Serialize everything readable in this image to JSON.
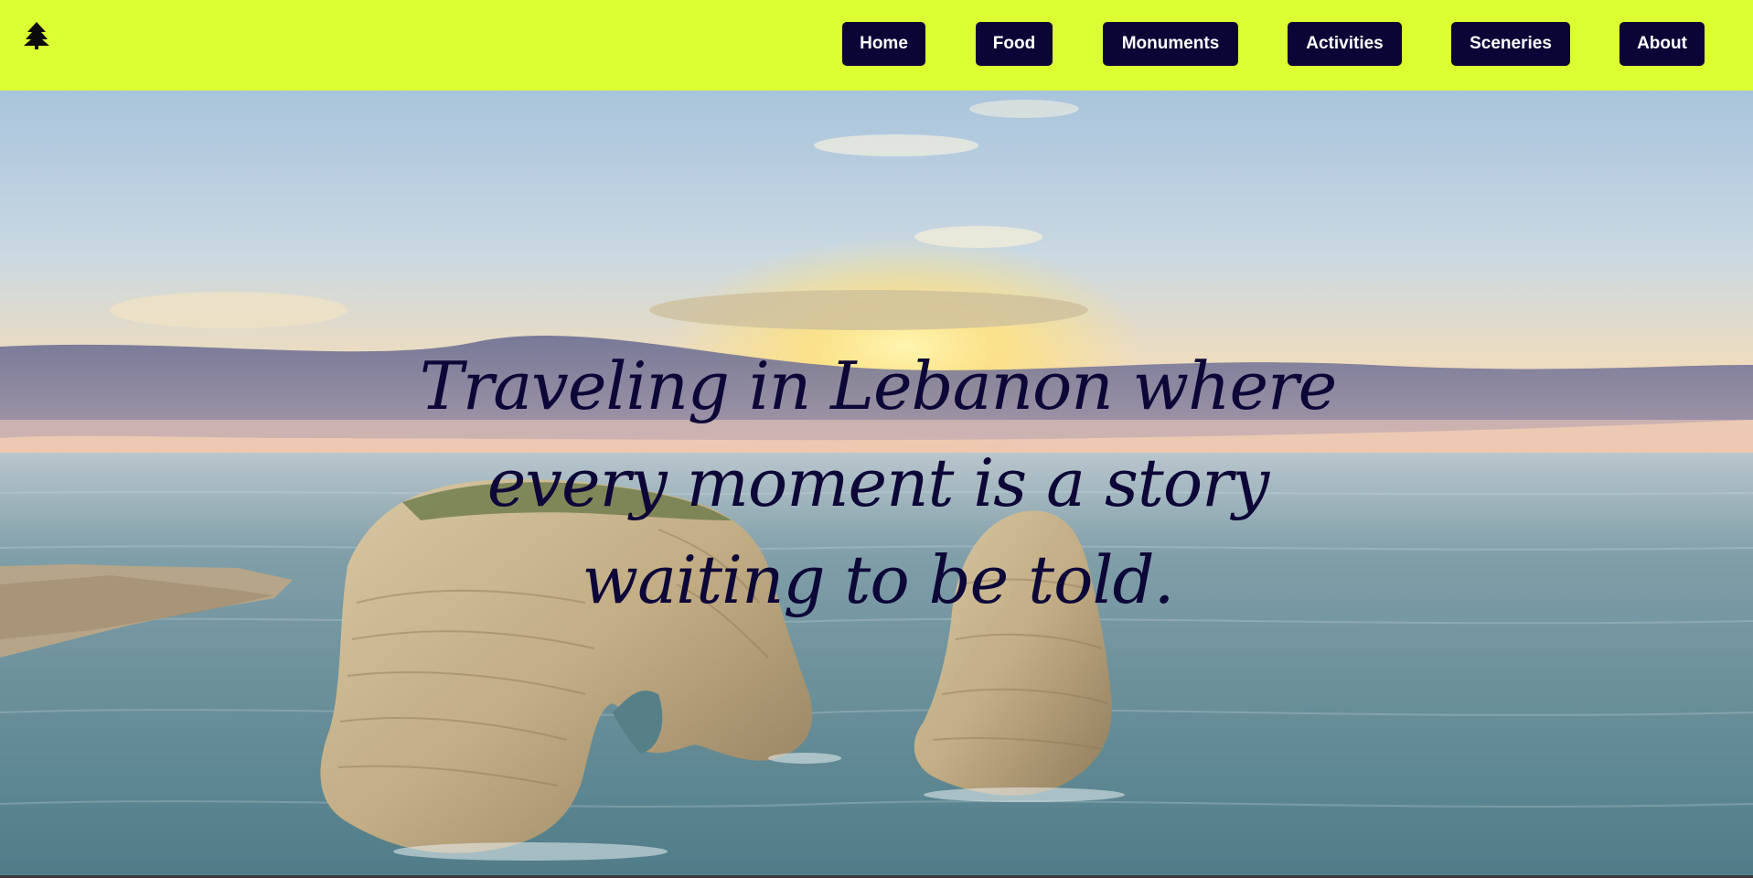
{
  "nav": {
    "logo_icon": "tree-icon",
    "items": [
      {
        "label": "Home"
      },
      {
        "label": "Food"
      },
      {
        "label": "Monuments"
      },
      {
        "label": "Activities"
      },
      {
        "label": "Sceneries"
      },
      {
        "label": "About"
      }
    ],
    "background_color": "#dcff33",
    "button_color": "#0a0536"
  },
  "hero": {
    "tagline": "Traveling in Lebanon where every moment is a story waiting to be told.",
    "image": "pigeon-rocks-sunset-photo"
  }
}
